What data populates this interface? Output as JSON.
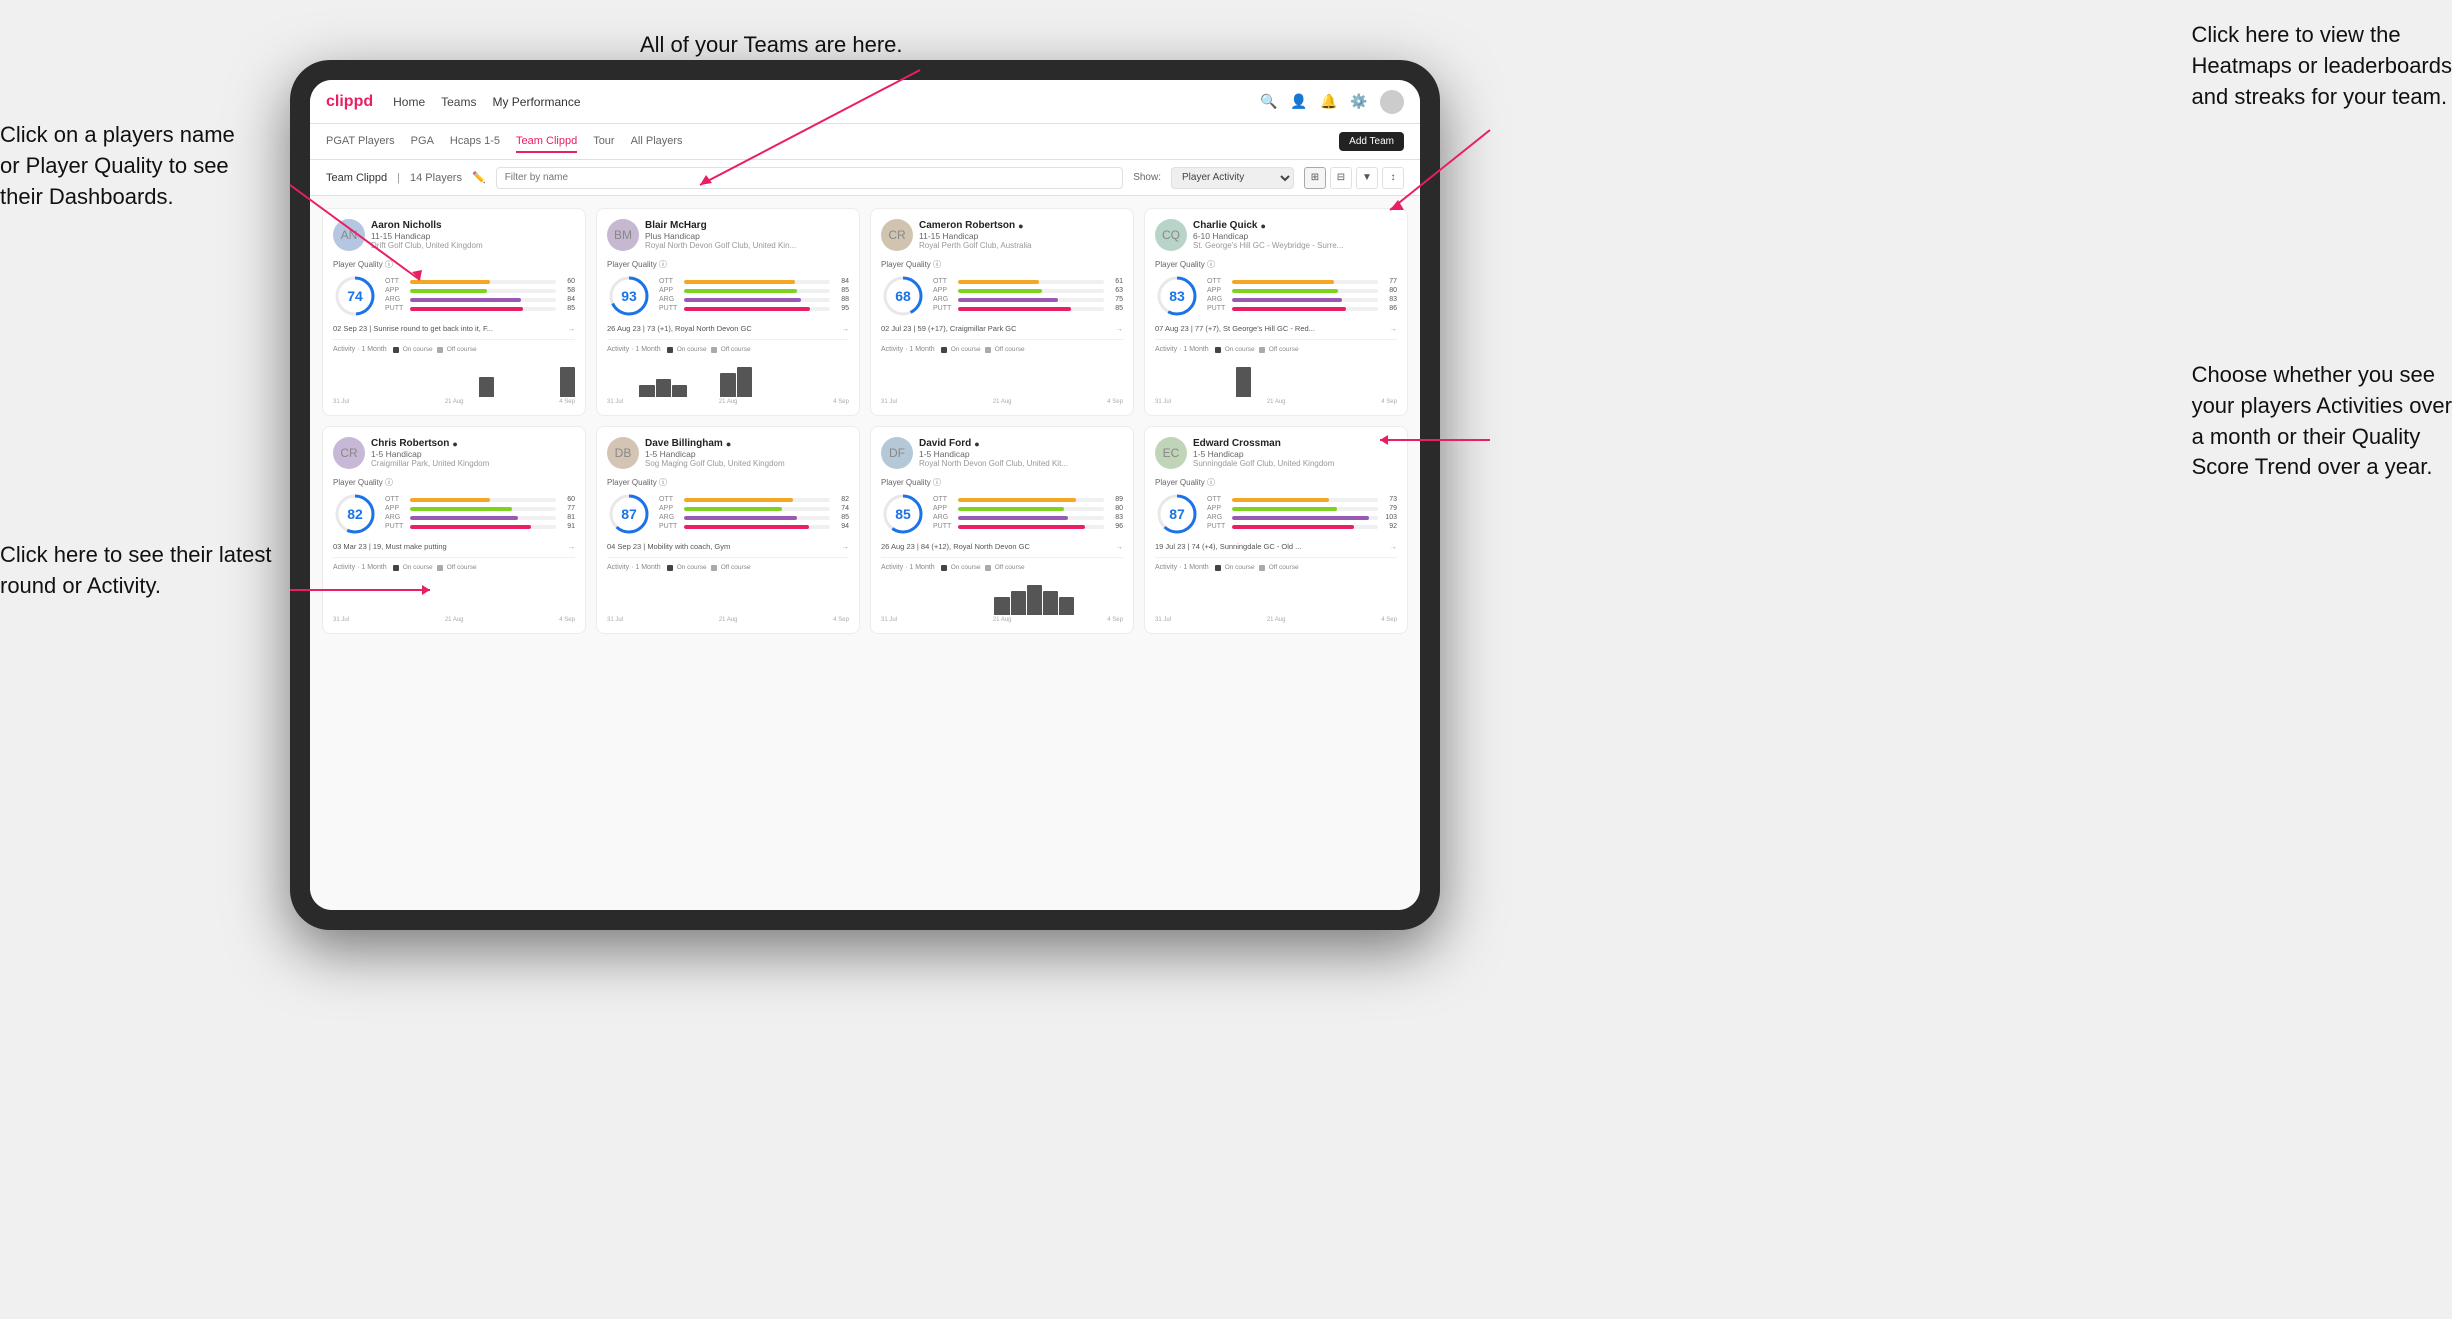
{
  "annotations": {
    "top_center": "All of your Teams are here.",
    "top_right_line1": "Click here to view the",
    "top_right_line2": "Heatmaps or leaderboards",
    "top_right_line3": "and streaks for your team.",
    "left_top_line1": "Click on a players name",
    "left_top_line2": "or Player Quality to see",
    "left_top_line3": "their Dashboards.",
    "left_bottom_line1": "Click here to see their latest",
    "left_bottom_line2": "round or Activity.",
    "right_bottom_line1": "Choose whether you see",
    "right_bottom_line2": "your players Activities over",
    "right_bottom_line3": "a month or their Quality",
    "right_bottom_line4": "Score Trend over a year."
  },
  "nav": {
    "logo": "clippd",
    "links": [
      "Home",
      "Teams",
      "My Performance"
    ],
    "icons": [
      "search",
      "person",
      "bell",
      "settings",
      "avatar"
    ]
  },
  "sub_nav": {
    "links": [
      "PGAT Players",
      "PGA",
      "Hcaps 1-5",
      "Team Clippd",
      "Tour",
      "All Players"
    ],
    "active": "Team Clippd",
    "add_team_label": "Add Team"
  },
  "team_bar": {
    "title": "Team Clippd",
    "count_label": "14 Players",
    "filter_placeholder": "Filter by name",
    "show_label": "Show:",
    "show_value": "Player Activity",
    "view_icons": [
      "grid-large",
      "grid-small",
      "filter",
      "sort"
    ]
  },
  "players": [
    {
      "name": "Aaron Nicholls",
      "handicap": "11-15 Handicap",
      "club": "Drift Golf Club, United Kingdom",
      "quality": 74,
      "ott": 60,
      "app": 58,
      "arg": 84,
      "putt": 85,
      "last_activity": "02 Sep 23 | Sunrise round to get back into it, F...",
      "chart_bars": [
        0,
        0,
        0,
        0,
        0,
        0,
        0,
        0,
        0,
        2,
        0,
        0,
        0,
        0,
        3
      ],
      "chart_labels": [
        "31 Jul",
        "21 Aug",
        "4 Sep"
      ],
      "verified": false
    },
    {
      "name": "Blair McHarg",
      "handicap": "Plus Handicap",
      "club": "Royal North Devon Golf Club, United Kin...",
      "quality": 93,
      "ott": 84,
      "app": 85,
      "arg": 88,
      "putt": 95,
      "last_activity": "26 Aug 23 | 73 (+1), Royal North Devon GC",
      "chart_bars": [
        0,
        0,
        2,
        3,
        2,
        0,
        0,
        4,
        5,
        0,
        0,
        0,
        0,
        0,
        0
      ],
      "chart_labels": [
        "31 Jul",
        "21 Aug",
        "4 Sep"
      ],
      "verified": false
    },
    {
      "name": "Cameron Robertson",
      "handicap": "11-15 Handicap",
      "club": "Royal Perth Golf Club, Australia",
      "quality": 68,
      "ott": 61,
      "app": 63,
      "arg": 75,
      "putt": 85,
      "last_activity": "02 Jul 23 | 59 (+17), Craigmillar Park GC",
      "chart_bars": [
        0,
        0,
        0,
        0,
        0,
        0,
        0,
        0,
        0,
        0,
        0,
        0,
        0,
        0,
        0
      ],
      "chart_labels": [
        "31 Jul",
        "21 Aug",
        "4 Sep"
      ],
      "verified": true
    },
    {
      "name": "Charlie Quick",
      "handicap": "6-10 Handicap",
      "club": "St. George's Hill GC - Weybridge - Surre...",
      "quality": 83,
      "ott": 77,
      "app": 80,
      "arg": 83,
      "putt": 86,
      "last_activity": "07 Aug 23 | 77 (+7), St George's Hill GC - Red...",
      "chart_bars": [
        0,
        0,
        0,
        0,
        0,
        2,
        0,
        0,
        0,
        0,
        0,
        0,
        0,
        0,
        0
      ],
      "chart_labels": [
        "31 Jul",
        "21 Aug",
        "4 Sep"
      ],
      "verified": true
    },
    {
      "name": "Chris Robertson",
      "handicap": "1-5 Handicap",
      "club": "Craigmillar Park, United Kingdom",
      "quality": 82,
      "ott": 60,
      "app": 77,
      "arg": 81,
      "putt": 91,
      "last_activity": "03 Mar 23 | 19, Must make putting",
      "chart_bars": [
        0,
        0,
        0,
        0,
        0,
        0,
        0,
        0,
        0,
        0,
        0,
        0,
        0,
        0,
        0
      ],
      "chart_labels": [
        "31 Jul",
        "21 Aug",
        "4 Sep"
      ],
      "verified": true
    },
    {
      "name": "Dave Billingham",
      "handicap": "1-5 Handicap",
      "club": "Sog Maging Golf Club, United Kingdom",
      "quality": 87,
      "ott": 82,
      "app": 74,
      "arg": 85,
      "putt": 94,
      "last_activity": "04 Sep 23 | Mobility with coach, Gym",
      "chart_bars": [
        0,
        0,
        0,
        0,
        0,
        0,
        0,
        0,
        0,
        0,
        0,
        0,
        0,
        0,
        0
      ],
      "chart_labels": [
        "31 Jul",
        "21 Aug",
        "4 Sep"
      ],
      "verified": true
    },
    {
      "name": "David Ford",
      "handicap": "1-5 Handicap",
      "club": "Royal North Devon Golf Club, United Kit...",
      "quality": 85,
      "ott": 89,
      "app": 80,
      "arg": 83,
      "putt": 96,
      "last_activity": "26 Aug 23 | 84 (+12), Royal North Devon GC",
      "chart_bars": [
        0,
        0,
        0,
        0,
        0,
        0,
        0,
        3,
        4,
        5,
        4,
        3,
        0,
        0,
        0
      ],
      "chart_labels": [
        "31 Jul",
        "21 Aug",
        "4 Sep"
      ],
      "verified": true
    },
    {
      "name": "Edward Crossman",
      "handicap": "1-5 Handicap",
      "club": "Sunningdale Golf Club, United Kingdom",
      "quality": 87,
      "ott": 73,
      "app": 79,
      "arg": 103,
      "putt": 92,
      "last_activity": "19 Jul 23 | 74 (+4), Sunningdale GC - Old ...",
      "chart_bars": [
        0,
        0,
        0,
        0,
        0,
        0,
        0,
        0,
        0,
        0,
        0,
        0,
        0,
        0,
        0
      ],
      "chart_labels": [
        "31 Jul",
        "21 Aug",
        "4 Sep"
      ],
      "verified": false
    }
  ],
  "activity_legend": {
    "title": "Activity · 1 Month",
    "on_course": "On course",
    "off_course": "Off course"
  }
}
